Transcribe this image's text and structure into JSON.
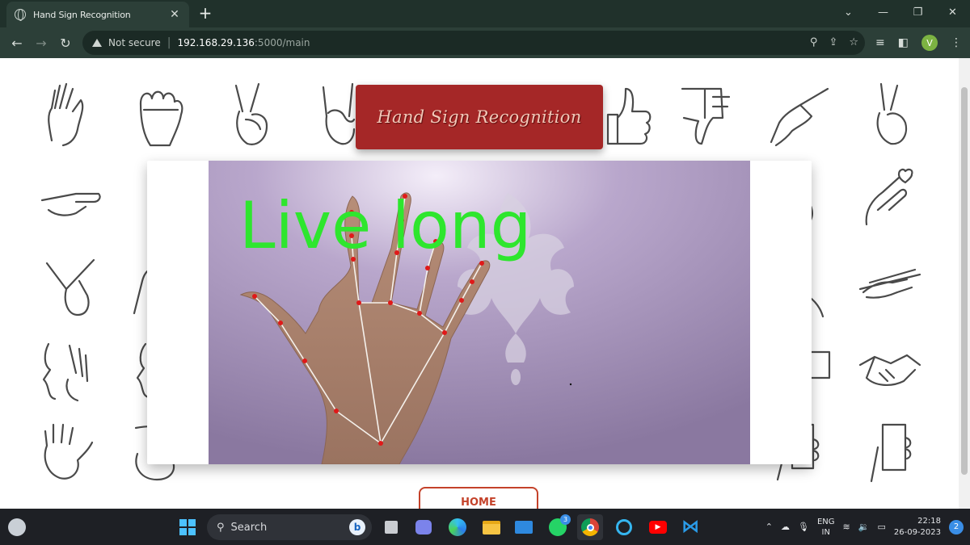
{
  "browser": {
    "tab_title": "Hand Sign Recognition",
    "url_warning": "Not secure",
    "url_host": "192.168.29.136",
    "url_path": ":5000/main",
    "profile_initial": "V"
  },
  "page": {
    "title": "Hand Sign Recognition",
    "prediction_label": "Live long",
    "home_button": "HOME"
  },
  "taskbar": {
    "search_label": "Search",
    "whatsapp_badge": "3",
    "language_line1": "ENG",
    "language_line2": "IN",
    "time": "22:18",
    "date": "26-09-2023",
    "notification_count": "2"
  },
  "colors": {
    "title_box": "#a52727",
    "prediction_text": "#2ee62e",
    "landmark": "#e01919",
    "home_border": "#c4422a"
  }
}
